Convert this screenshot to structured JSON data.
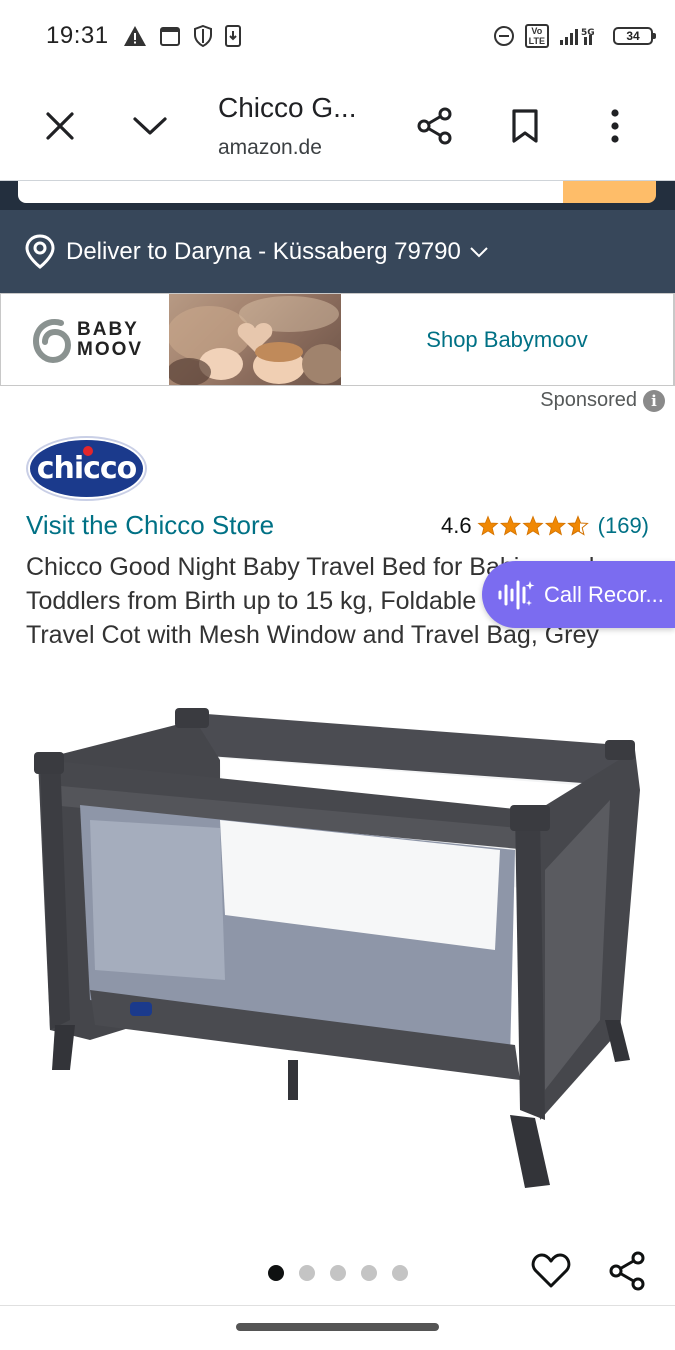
{
  "status_bar": {
    "time": "19:31",
    "calendar_day": "31",
    "battery": "34",
    "network": "5G",
    "volte": "Vo LTE"
  },
  "browser": {
    "title": "Chicco G...",
    "url": "amazon.de",
    "icons": [
      "close-icon",
      "chevron-down-icon",
      "share-icon",
      "bookmark-icon",
      "more-vert-icon"
    ]
  },
  "delivery": {
    "text": "Deliver to Daryna - Küssaberg 79790"
  },
  "ad": {
    "logo_line1": "BABY",
    "logo_line2": "MOOV",
    "cta": "Shop Babymoov",
    "sponsored": "Sponsored"
  },
  "brand": {
    "logo_text": "chicco",
    "store_link": "Visit the Chicco Store"
  },
  "rating": {
    "value": "4.6",
    "stars": 4.6,
    "count": "(169)"
  },
  "product": {
    "title": "Chicco Good Night Baby Travel Bed for Babies and Toddlers from Birth up to 15 kg, Foldable and Compact, Travel Cot with Mesh Window and Travel Bag, Grey"
  },
  "overlay": {
    "call_recorder": "Call Recor..."
  },
  "carousel": {
    "total": 5,
    "active_index": 0
  },
  "colors": {
    "deliver_bg": "#37475a",
    "link": "#007185",
    "star": "#f08804",
    "search_button": "#febd69",
    "overlay_pill": "#7b6cf0"
  }
}
